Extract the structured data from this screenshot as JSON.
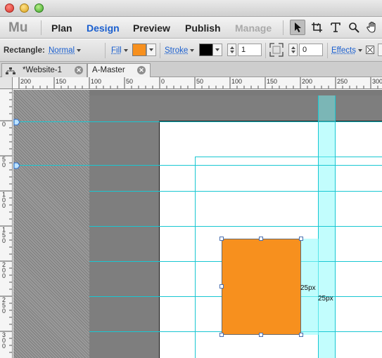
{
  "nav": {
    "logo": "Mu",
    "items": [
      {
        "label": "Plan"
      },
      {
        "label": "Design"
      },
      {
        "label": "Preview"
      },
      {
        "label": "Publish"
      },
      {
        "label": "Manage"
      }
    ],
    "active": "Design",
    "disabled": "Manage",
    "tools": [
      "selection-arrow-icon",
      "crop-icon",
      "text-tool-icon",
      "zoom-icon",
      "hand-icon"
    ]
  },
  "control": {
    "object_type": "Rectangle:",
    "style_value": "Normal",
    "fill_label": "Fill",
    "fill_color": "#f7901e",
    "stroke_label": "Stroke",
    "stroke_color": "#000000",
    "stroke_width": "1",
    "corner_radius": "0",
    "effects_label": "Effects"
  },
  "tabs": [
    {
      "label": "*Website-1",
      "icon": "sitemap-icon"
    },
    {
      "label": "A-Master"
    }
  ],
  "ruler": {
    "h_labels": [
      "200",
      "150",
      "100",
      "50",
      "0",
      "50",
      "100",
      "150",
      "200",
      "250",
      "300"
    ],
    "v_labels": [
      "0",
      "5\n0",
      "1\n0\n0",
      "1\n5\n0",
      "2\n0\n0",
      "2\n5\n0",
      "3\n0\n0"
    ]
  },
  "canvas": {
    "rect_color": "#f7901e",
    "spacing_label_1": "25px",
    "spacing_label_2": "25px"
  }
}
